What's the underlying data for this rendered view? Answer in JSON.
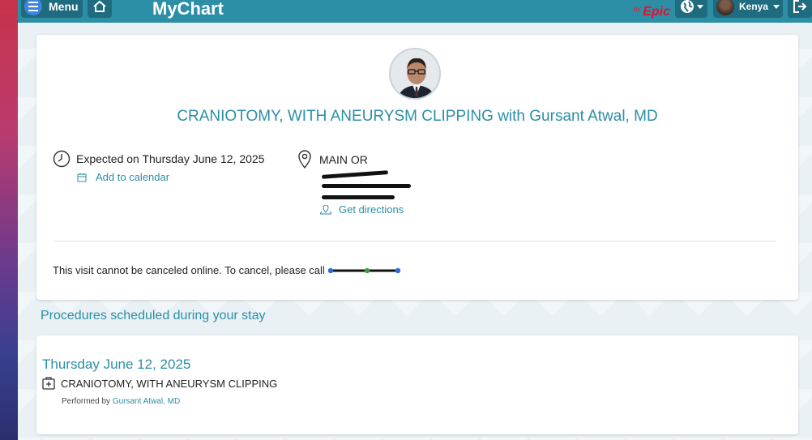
{
  "header": {
    "menu_label": "Menu",
    "logo_text": "MyChart",
    "epic_by": "by",
    "epic_word": "Epic",
    "user_name": "Kenya"
  },
  "visit": {
    "title": "CRANIOTOMY, WITH ANEURYSM CLIPPING with Gursant Atwal, MD",
    "expected": "Expected on Thursday June 12, 2025",
    "add_calendar": "Add to calendar",
    "location_name": "MAIN OR",
    "get_directions": "Get directions",
    "cancel_text": "This visit cannot be canceled online. To cancel, please call"
  },
  "procedures": {
    "heading": "Procedures scheduled during your stay",
    "date": "Thursday June 12, 2025",
    "name": "CRANIOTOMY, WITH ANEURYSM CLIPPING",
    "performed_by_label": "Performed by",
    "performed_by_name": "Gursant Atwal, MD"
  },
  "colors": {
    "brand": "#2d8fa6",
    "link": "#2b8fa6"
  }
}
